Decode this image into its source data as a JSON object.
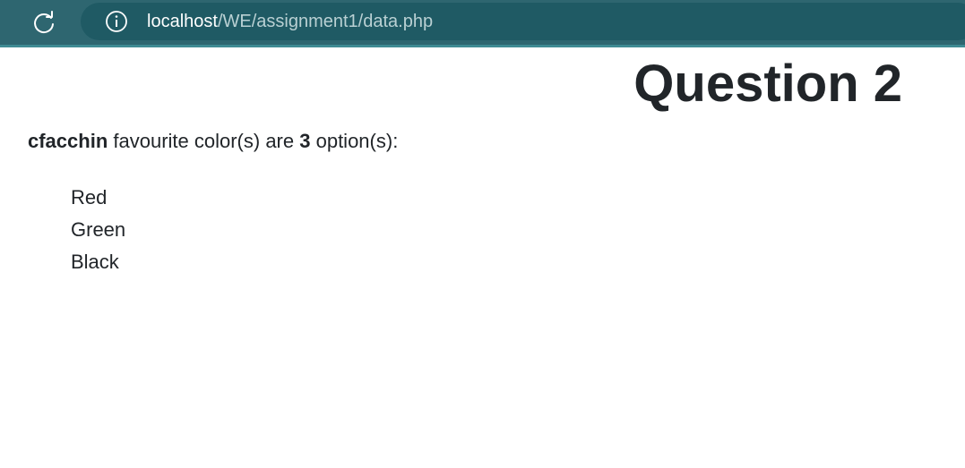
{
  "browser": {
    "url_host": "localhost",
    "url_path": "/WE/assignment1/data.php",
    "icons": {
      "reload": "reload-icon",
      "info": "info-icon"
    },
    "colors": {
      "toolbar": "#2e6670",
      "address_bar": "#1f5a64",
      "accent_line": "#3f8b93"
    }
  },
  "page": {
    "title": "Question 2",
    "summary": {
      "username": "cfacchin",
      "text_before_count": " favourite color(s) are ",
      "count": "3",
      "text_after_count": " option(s):"
    },
    "colors": [
      "Red",
      "Green",
      "Black"
    ]
  }
}
